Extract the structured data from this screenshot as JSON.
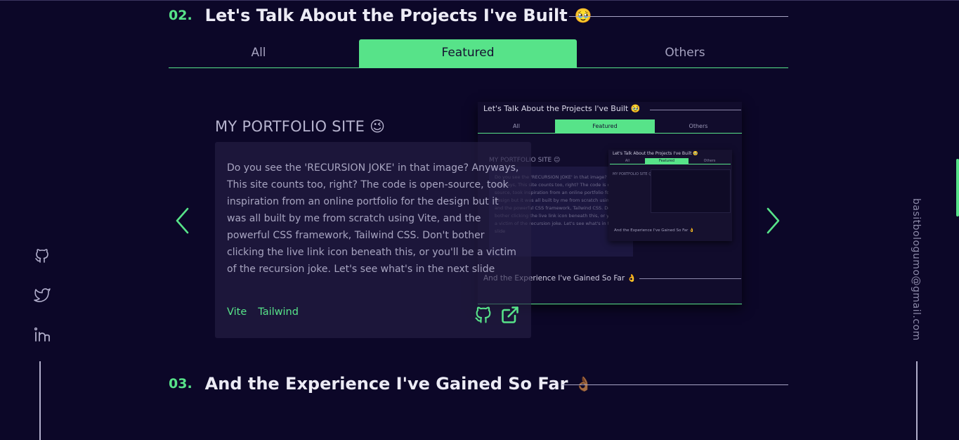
{
  "projects_section": {
    "number": "02.",
    "title": "Let's Talk About the Projects I've Built",
    "emoji": "🥹"
  },
  "tabs": [
    {
      "label": "All",
      "active": false
    },
    {
      "label": "Featured",
      "active": true
    },
    {
      "label": "Others",
      "active": false
    }
  ],
  "project": {
    "title": "MY PORTFOLIO SITE",
    "emoji": "😉",
    "description": "Do you see the 'RECURSION JOKE' in that image? Anyways, This site counts too, right? The code is open-source, took inspiration from an online portfolio for the design but it was all built by me from scratch using Vite, and the powerful CSS framework, Tailwind CSS. Don't bother clicking the live link icon beneath this, or you'll be a victim of the recursion joke. Let's see what's in the next slide",
    "tags": [
      "Vite",
      "Tailwind"
    ],
    "github_icon": "github-icon",
    "live_icon": "external-link-icon"
  },
  "preview": {
    "title": "Let's Talk About the Projects I've Built 🥹",
    "tabs": [
      "All",
      "Featured",
      "Others"
    ],
    "project_title": "MY PORTFOLIO SITE 😉",
    "description": "Do you see the 'RECURSION JOKE' in that image? Anyways, This site counts too, right? The code is open-source, took inspiration from an online portfolio for the design but it was all built by me from scratch using Vite, and the powerful CSS framework, Tailwind CSS. Don't bother clicking the live link icon beneath this, or you'll be a victim of the recursion joke. Let's see what's in the next slide",
    "tags": "Vite   Tailwind",
    "mini_title": "Let's Talk About the Projects I've Built 🥹",
    "mini_tabs": [
      "All",
      "Featured",
      "Others"
    ],
    "mini_project": "MY PORTFOLIO SITE 😉",
    "mini_footer": "And the Experience I've Gained So Far 👌",
    "experience": "And the Experience I've Gained So Far 👌"
  },
  "experience_section": {
    "number": "03.",
    "title": "And the Experience I've Gained So Far",
    "emoji": "👌🏾"
  },
  "socials": [
    {
      "name": "github-icon"
    },
    {
      "name": "twitter-icon"
    },
    {
      "name": "linkedin-icon"
    }
  ],
  "email": "basitbologumo@gmail.com",
  "colors": {
    "background": "#0c0728",
    "accent": "#57e389",
    "card": "#221d44"
  }
}
